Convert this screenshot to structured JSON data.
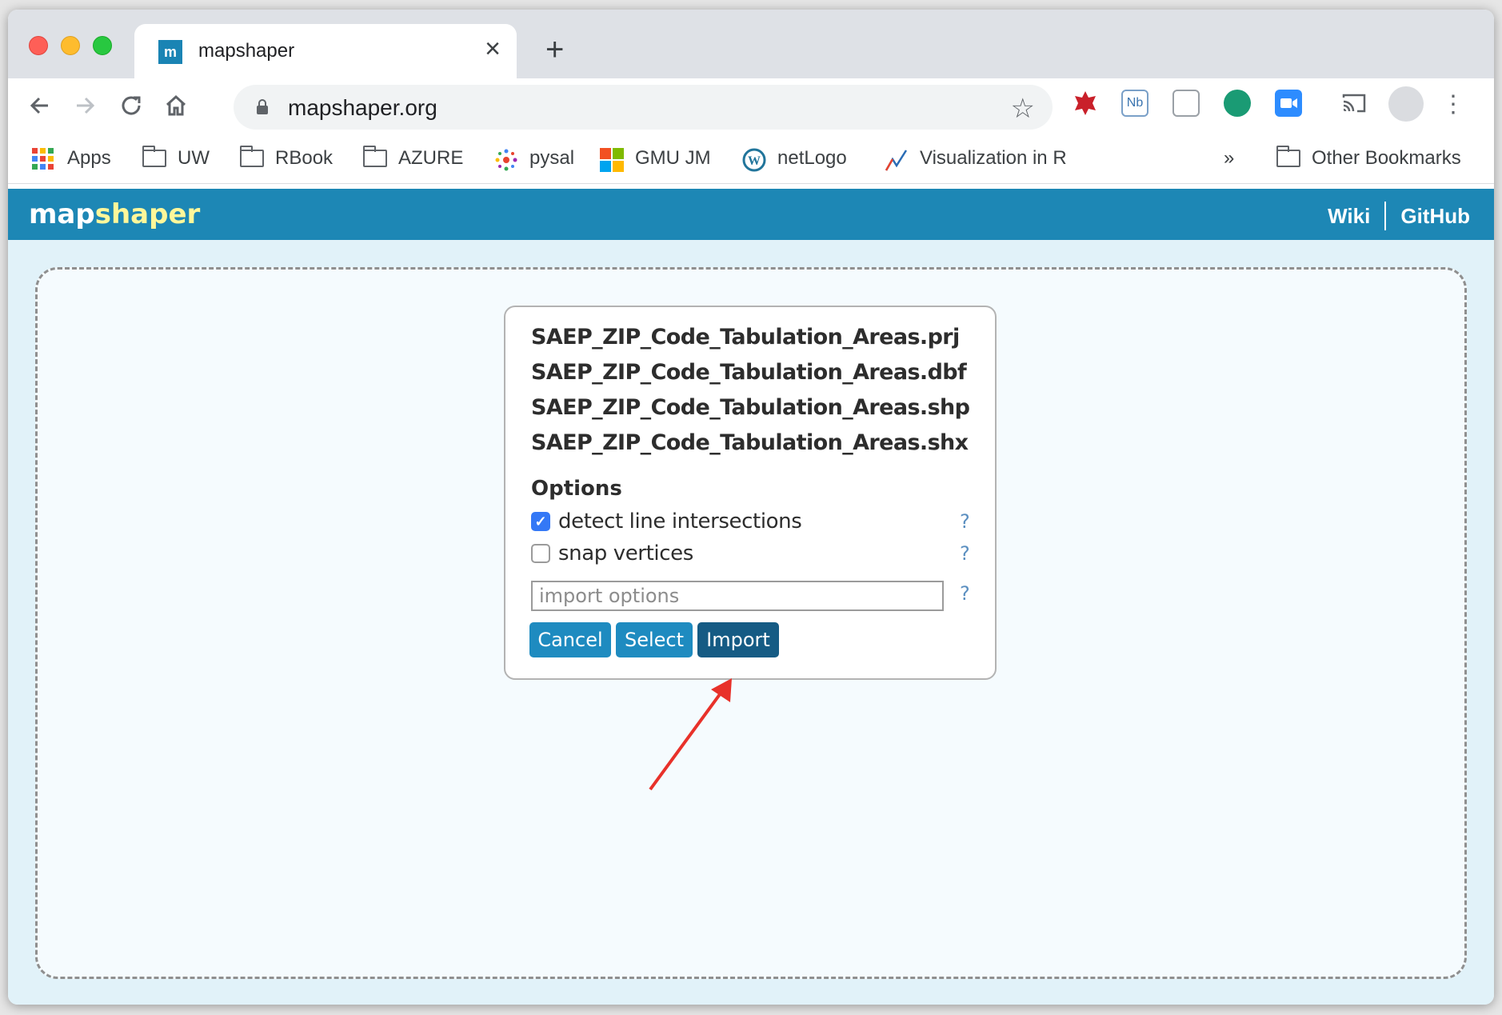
{
  "browser": {
    "tab_title": "mapshaper",
    "tab_favicon": "mapshaper-logo-icon",
    "url": "mapshaper.org",
    "bookmarks": [
      "Apps",
      "UW",
      "RBook",
      "AZURE",
      "pysal",
      "GMU JM",
      "netLogo",
      "Visualization in R"
    ],
    "overflow": "»",
    "other_bookmarks": "Other Bookmarks"
  },
  "app": {
    "logo_map": "map",
    "logo_shaper": "shaper",
    "nav": [
      "Wiki",
      "GitHub"
    ]
  },
  "import_dialog": {
    "files": [
      "SAEP_ZIP_Code_Tabulation_Areas.prj",
      "SAEP_ZIP_Code_Tabulation_Areas.dbf",
      "SAEP_ZIP_Code_Tabulation_Areas.shp",
      "SAEP_ZIP_Code_Tabulation_Areas.shx"
    ],
    "options_heading": "Options",
    "options": [
      {
        "label": "detect line intersections",
        "checked": true,
        "help": "?"
      },
      {
        "label": "snap vertices",
        "checked": false,
        "help": "?"
      }
    ],
    "import_options_placeholder": "import options",
    "import_options_help": "?",
    "buttons": {
      "cancel": "Cancel",
      "select": "Select",
      "import": "Import"
    }
  },
  "colors": {
    "app_header": "#1d87b5",
    "logo_accent": "#fff79a",
    "button": "#1e8bc0",
    "button_primary": "#155b84",
    "annotation_arrow": "#e8312a"
  }
}
